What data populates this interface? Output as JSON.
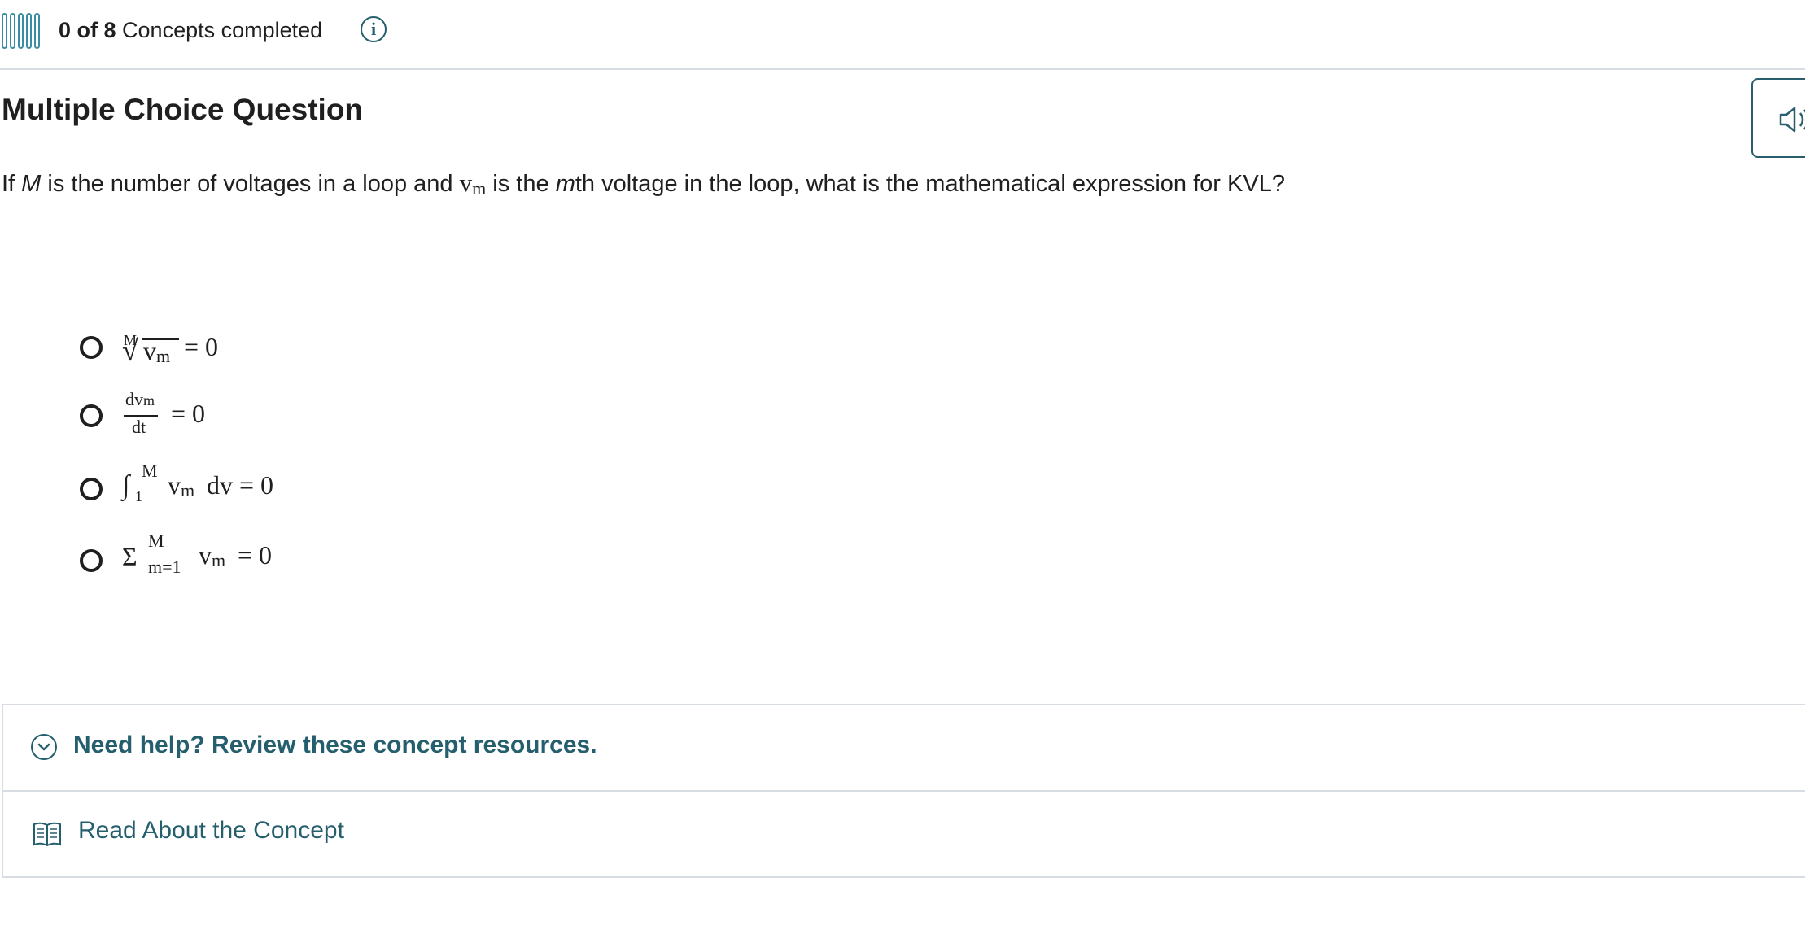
{
  "header": {
    "progress_count": "0 of 8",
    "progress_label": "Concepts completed",
    "info_glyph": "i",
    "icons": [
      "progress-bars-icon",
      "info-icon"
    ]
  },
  "question": {
    "type_label": "Multiple Choice Question",
    "audio_icon": "speaker-icon",
    "prompt": {
      "p1": "If ",
      "M": "M",
      "p2": " is the number of voltages in a loop and ",
      "v": "v",
      "m_sub": "m",
      "p3": " is the ",
      "m": "m",
      "p4": "th voltage in the loop, what is the mathematical expression for KVL?"
    }
  },
  "options": [
    {
      "index": "M",
      "radical": "√",
      "body": "v",
      "sub": "m",
      "rhs": "= 0"
    },
    {
      "num_v": "dv",
      "num_sub": "m",
      "den": "dt",
      "rhs": "= 0"
    },
    {
      "integral": "∫",
      "upper": "M",
      "lower": "1",
      "body": "v",
      "sub": "m",
      "tail": "dv = 0"
    },
    {
      "sigma": "Σ",
      "upper": "M",
      "lower": "m=1",
      "body": "v",
      "sub": "m",
      "rhs": "= 0"
    }
  ],
  "help": {
    "title": "Need help? Review these concept resources.",
    "read_link": "Read About the Concept",
    "icons": [
      "chevron-down-icon",
      "book-icon"
    ]
  },
  "colors": {
    "accent": "#255f6e",
    "progress": "#3a8ea3",
    "divider": "#d7dde3",
    "text": "#1f1f1f"
  }
}
